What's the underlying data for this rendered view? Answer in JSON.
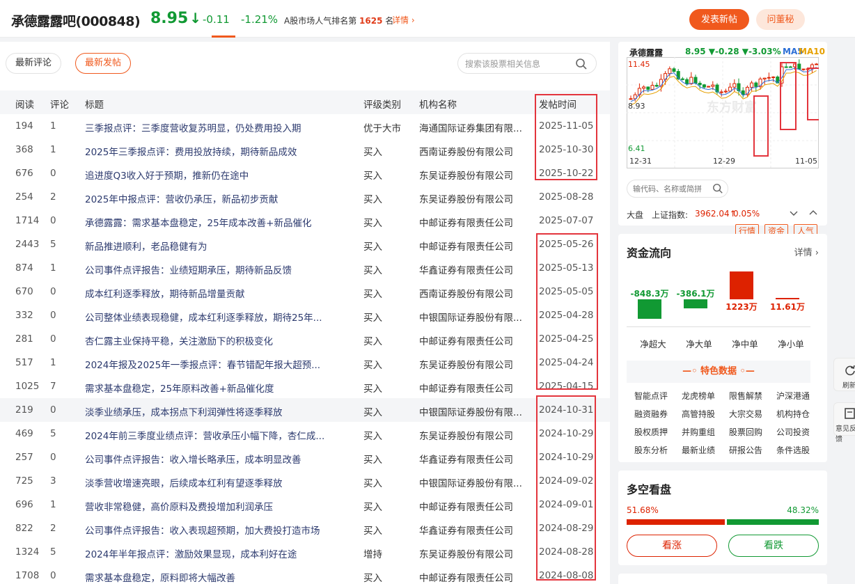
{
  "header": {
    "name": "承德露露吧(000848)",
    "price": "8.95",
    "arrow": "↓",
    "change": "-0.11",
    "change_pct": "-1.21%",
    "rank_prefix": "A股市场人气排名第",
    "rank_num": "1625",
    "rank_suffix": "名",
    "detail": "详情",
    "post_button": "发表新帖",
    "ask_button": "问董秘"
  },
  "tabs": [
    "最新评论",
    "最新发帖"
  ],
  "search": {
    "placeholder": "搜索该股票相关信息"
  },
  "columns": [
    "阅读",
    "评论",
    "标题",
    "评级类别",
    "机构名称",
    "发帖时间"
  ],
  "rows": [
    {
      "read": "194",
      "comments": "1",
      "title": "三季报点评：三季度营收复苏明显，仍处费用投入期",
      "rating": "优于大市",
      "org": "海通国际证券集团有限...",
      "date": "2025-11-05"
    },
    {
      "read": "368",
      "comments": "1",
      "title": "2025年三季报点评：费用投放持续，期待新品成效",
      "rating": "买入",
      "org": "西南证券股份有限公司",
      "date": "2025-10-30"
    },
    {
      "read": "676",
      "comments": "0",
      "title": "追进度Q3收入好于预期，推新仍在途中",
      "rating": "买入",
      "org": "东吴证券股份有限公司",
      "date": "2025-10-22"
    },
    {
      "read": "254",
      "comments": "2",
      "title": "2025年中报点评：营收仍承压，新品初步贡献",
      "rating": "买入",
      "org": "东吴证券股份有限公司",
      "date": "2025-08-28"
    },
    {
      "read": "1714",
      "comments": "0",
      "title": "承德露露：需求基本盘稳定，25年成本改善+新品催化",
      "rating": "买入",
      "org": "中邮证券有限责任公司",
      "date": "2025-07-07"
    },
    {
      "read": "2443",
      "comments": "5",
      "title": "新品推进顺利，老品稳健有为",
      "rating": "买入",
      "org": "中邮证券有限责任公司",
      "date": "2025-05-26"
    },
    {
      "read": "874",
      "comments": "1",
      "title": "公司事件点评报告：业绩短期承压，期待新品反馈",
      "rating": "买入",
      "org": "华鑫证券有限责任公司",
      "date": "2025-05-13"
    },
    {
      "read": "670",
      "comments": "0",
      "title": "成本红利逐季释放，期待新品增量贡献",
      "rating": "买入",
      "org": "西南证券股份有限公司",
      "date": "2025-05-05"
    },
    {
      "read": "332",
      "comments": "0",
      "title": "公司整体业绩表现稳健，成本红利逐季释放，期待25年...",
      "rating": "买入",
      "org": "中银国际证券股份有限...",
      "date": "2025-04-28"
    },
    {
      "read": "281",
      "comments": "0",
      "title": "杏仁露主业保持平稳，关注激励下的积极变化",
      "rating": "买入",
      "org": "中邮证券有限责任公司",
      "date": "2025-04-25"
    },
    {
      "read": "517",
      "comments": "1",
      "title": "2024年报及2025年一季报点评：春节错配年报大超预...",
      "rating": "买入",
      "org": "东吴证券股份有限公司",
      "date": "2025-04-24"
    },
    {
      "read": "1025",
      "comments": "7",
      "title": "需求基本盘稳定，25年原料改善+新品催化度",
      "rating": "买入",
      "org": "中邮证券有限责任公司",
      "date": "2025-04-15"
    },
    {
      "read": "219",
      "comments": "0",
      "title": "淡季业绩承压，成本拐点下利润弹性将逐季释放",
      "rating": "买入",
      "org": "中银国际证券股份有限...",
      "date": "2024-10-31"
    },
    {
      "read": "469",
      "comments": "5",
      "title": "2024年前三季度业绩点评：营收承压小幅下降，杏仁成...",
      "rating": "买入",
      "org": "东吴证券股份有限公司",
      "date": "2024-10-29"
    },
    {
      "read": "257",
      "comments": "0",
      "title": "公司事件点评报告：收入增长略承压，成本明显改善",
      "rating": "买入",
      "org": "华鑫证券有限责任公司",
      "date": "2024-10-29"
    },
    {
      "read": "725",
      "comments": "3",
      "title": "淡季营收增速亮眼，后续成本红利有望逐季释放",
      "rating": "买入",
      "org": "中银国际证券股份有限...",
      "date": "2024-09-02"
    },
    {
      "read": "696",
      "comments": "1",
      "title": "营收非常稳健，高价原料及费投增加利润承压",
      "rating": "买入",
      "org": "中邮证券有限责任公司",
      "date": "2024-09-01"
    },
    {
      "read": "822",
      "comments": "2",
      "title": "公司事件点评报告：收入表现超预期，加大费投打造市场",
      "rating": "买入",
      "org": "华鑫证券有限责任公司",
      "date": "2024-08-29"
    },
    {
      "read": "1324",
      "comments": "5",
      "title": "2024年半年报点评：激励效果显现，成本利好在途",
      "rating": "增持",
      "org": "东吴证券股份有限公司",
      "date": "2024-08-28"
    },
    {
      "read": "1708",
      "comments": "0",
      "title": "需求基本盘稳定，原料即将大幅改善",
      "rating": "买入",
      "org": "中邮证券有限责任公司",
      "date": "2024-08-08"
    }
  ],
  "kline": {
    "name": "承德露露",
    "quote": "8.95 ▼-0.28 ▼-3.03%",
    "ma5": "MA5",
    "ma10": "MA10",
    "high": "11.45",
    "mid": "8.93",
    "low": "6.41",
    "dates": [
      "12-31",
      "12-29",
      "11-05"
    ],
    "watermark": "东方财富",
    "search_placeholder": "输代码、名称或简拼",
    "tags": [
      "行情",
      "资金",
      "人气"
    ],
    "market": "大盘",
    "index_name": "上证指数:",
    "index_value": "3962.04↑",
    "index_pct": "0.05%"
  },
  "fund_flow": {
    "title": "资金流向",
    "more": "详情",
    "items": [
      {
        "label": "净超大",
        "value": "-848.3万",
        "amount": -848.3
      },
      {
        "label": "净大单",
        "value": "-386.1万",
        "amount": -386.1
      },
      {
        "label": "净中单",
        "value": "1223万",
        "amount": 1223
      },
      {
        "label": "净小单",
        "value": "11.61万",
        "amount": 11.61
      }
    ],
    "colors": {
      "up": "#dd2200",
      "down": "#119933"
    },
    "special_title": "特色数据",
    "features": [
      "智能点评",
      "龙虎榜单",
      "限售解禁",
      "沪深港通",
      "融资融券",
      "高管持股",
      "大宗交易",
      "机构持仓",
      "股权质押",
      "并购重组",
      "股票回购",
      "公司投资",
      "股东分析",
      "最新业绩",
      "研报公告",
      "条件选股"
    ]
  },
  "sentiment": {
    "title": "多空看盘",
    "bull_pct": "51.68%",
    "bear_pct": "48.32%",
    "bull": 51.68,
    "bear_btn": "看跌",
    "bull_btn": "看涨"
  },
  "float_buttons": [
    "刷新",
    "意见反馈"
  ],
  "colors": {
    "accent": "#f0591d",
    "rise": "#dd2200",
    "fall": "#119933",
    "box": "#e3343c"
  }
}
